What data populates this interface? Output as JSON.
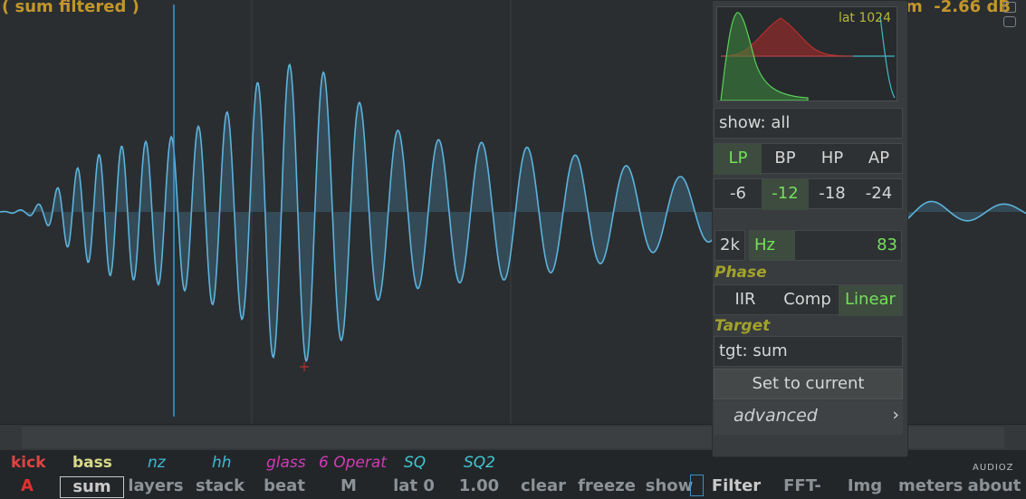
{
  "header": {
    "title": "( sum filtered )",
    "gain": "m  -2.66 dB"
  },
  "icons": {
    "window": "window-icon",
    "camera": "camera-icon"
  },
  "colors": {
    "wave": "#5cb3dc",
    "accent_green": "#74e05a",
    "title_gold": "#c2962a",
    "cursor": "#3e9ad0"
  },
  "panel": {
    "latency": "lat 1024",
    "show": "show: all",
    "filter_types": [
      "LP",
      "BP",
      "HP",
      "AP"
    ],
    "filter_type_selected": "LP",
    "slopes": [
      "-6",
      "-12",
      "-18",
      "-24"
    ],
    "slope_selected": "-12",
    "range_button": "2k",
    "freq_unit": "Hz",
    "freq_value": "83",
    "phase_label": "Phase",
    "phase_modes": [
      "IIR",
      "Comp",
      "Linear"
    ],
    "phase_selected": "Linear",
    "target_label": "Target",
    "target": "tgt: sum",
    "set_button": "Set to current",
    "advanced": "advanced",
    "advanced_arrow": "›"
  },
  "layers": [
    {
      "name": "kick",
      "color": "#e04343"
    },
    {
      "name": "bass",
      "color": "#d9d98a"
    },
    {
      "name": "nz",
      "color": "#3fb8d4"
    },
    {
      "name": "hh",
      "color": "#3fb8d4"
    },
    {
      "name": "glass",
      "color": "#d23ab6"
    },
    {
      "name": "6 Operat",
      "color": "#d23ab6"
    },
    {
      "name": "SQ",
      "color": "#3fc8d4"
    },
    {
      "name": "SQ2",
      "color": "#3fc8d4"
    }
  ],
  "toolbar": [
    "A",
    "sum",
    "layers",
    "stack",
    "beat",
    "M",
    "lat 0",
    "1.00",
    "clear",
    "freeze",
    "show",
    "Filter",
    "FFT-",
    "Img",
    "meters",
    "about"
  ],
  "watermark": "AUDIOZ"
}
